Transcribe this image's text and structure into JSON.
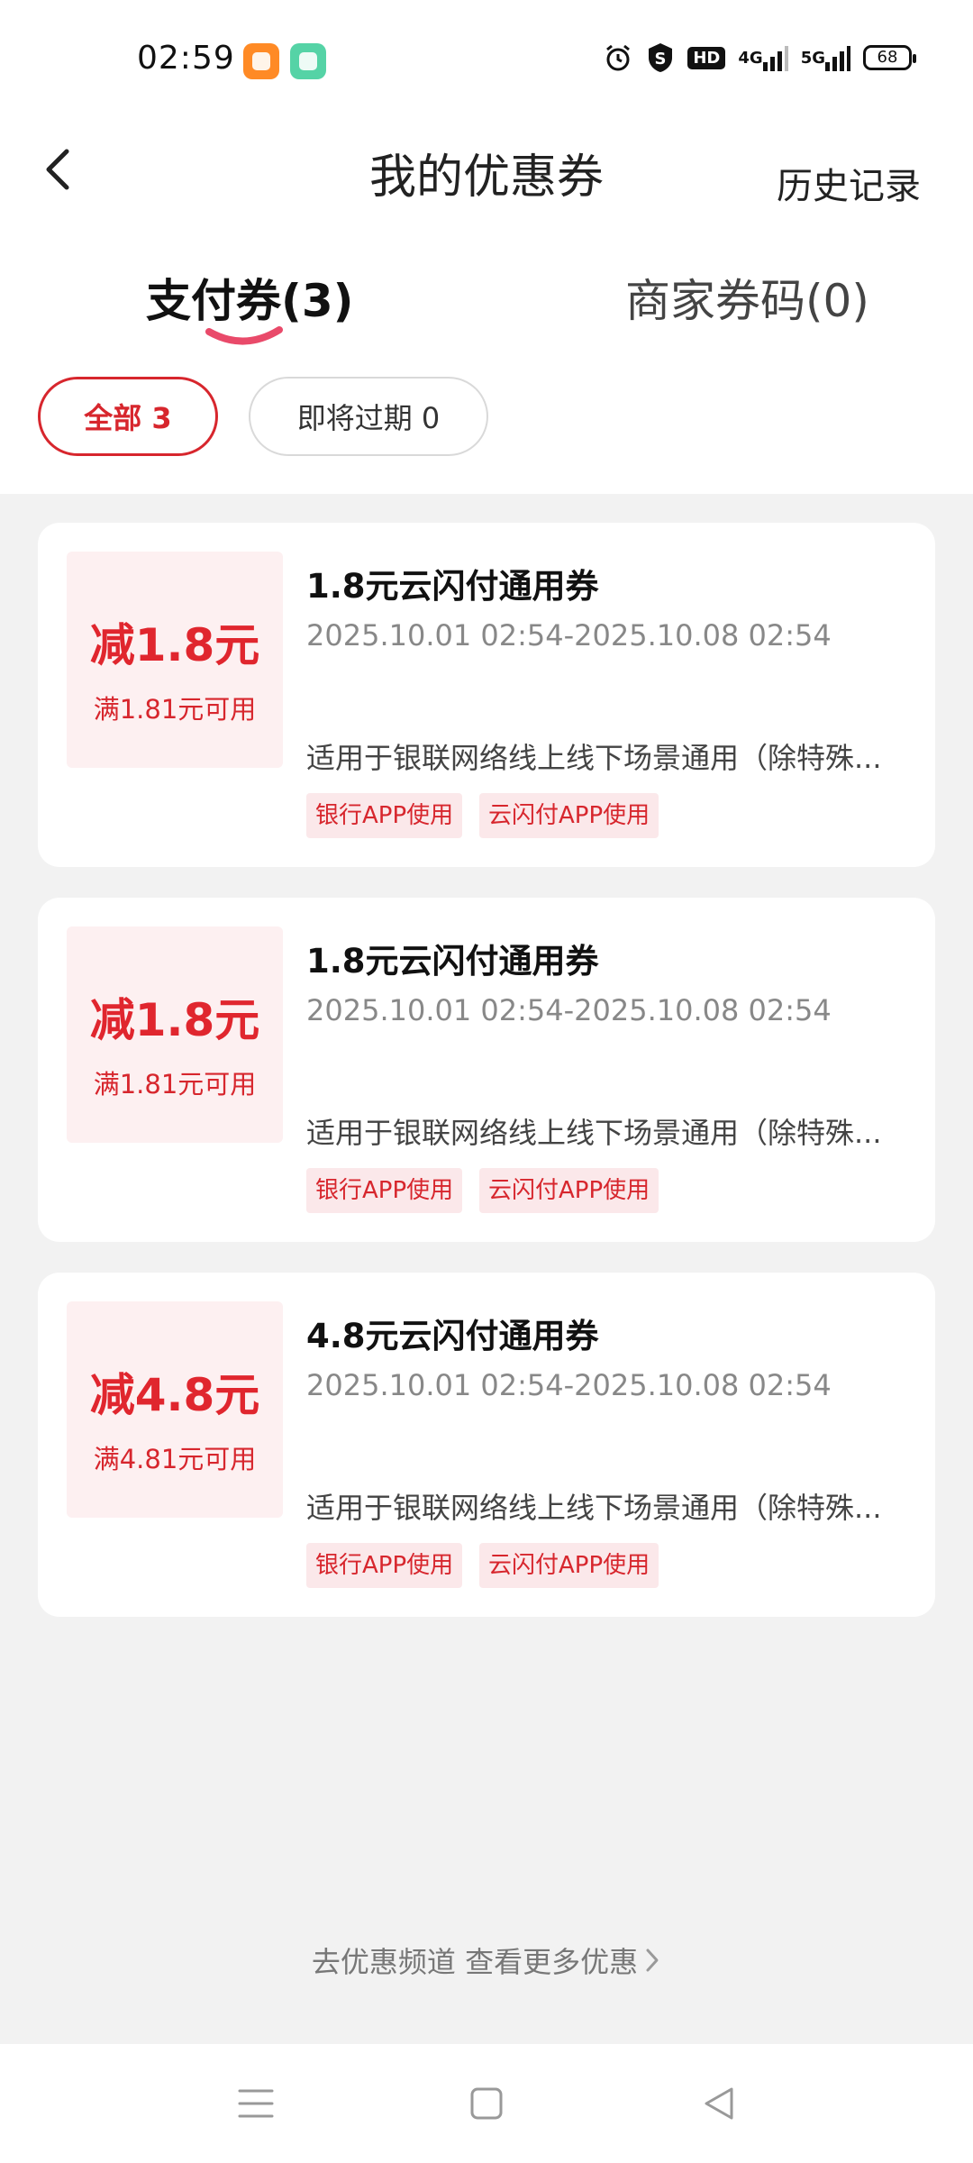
{
  "status_bar": {
    "time": "02:59",
    "icons": [
      "app-badge-orange",
      "app-badge-green",
      "alarm-icon",
      "s-shield-icon",
      "hd-icon",
      "signal-4g-icon",
      "signal-5g-icon",
      "battery-icon"
    ],
    "hd_label": "HD",
    "net1_label": "4G",
    "net2_label": "5G",
    "battery": "68"
  },
  "header": {
    "title": "我的优惠券",
    "history": "历史记录",
    "back_icon": "chevron-left-icon"
  },
  "tabs": [
    {
      "label": "支付券(3)",
      "active": true
    },
    {
      "label": "商家券码(0)",
      "active": false
    }
  ],
  "filters": [
    {
      "label": "全部 3",
      "active": true
    },
    {
      "label": "即将过期 0",
      "active": false
    }
  ],
  "coupons": [
    {
      "amount": "减1.8元",
      "condition": "满1.81元可用",
      "title": "1.8元云闪付通用券",
      "validity": "2025.10.01 02:54-2025.10.08 02:54",
      "description": "适用于银联网络线上线下场景通用（除特殊...",
      "tags": [
        "银行APP使用",
        "云闪付APP使用"
      ]
    },
    {
      "amount": "减1.8元",
      "condition": "满1.81元可用",
      "title": "1.8元云闪付通用券",
      "validity": "2025.10.01 02:54-2025.10.08 02:54",
      "description": "适用于银联网络线上线下场景通用（除特殊...",
      "tags": [
        "银行APP使用",
        "云闪付APP使用"
      ]
    },
    {
      "amount": "减4.8元",
      "condition": "满4.81元可用",
      "title": "4.8元云闪付通用券",
      "validity": "2025.10.01 02:54-2025.10.08 02:54",
      "description": "适用于银联网络线上线下场景通用（除特殊...",
      "tags": [
        "银行APP使用",
        "云闪付APP使用"
      ]
    }
  ],
  "footer": {
    "more_link": "去优惠频道 查看更多优惠"
  },
  "colors": {
    "accent": "#d7262d",
    "amount_bg": "#fdf0f1",
    "tag_bg": "#fbe8ea",
    "page_bg": "#f2f2f2"
  },
  "nav_bar": {
    "icons": [
      "menu-icon",
      "home-square-icon",
      "back-triangle-icon"
    ]
  }
}
